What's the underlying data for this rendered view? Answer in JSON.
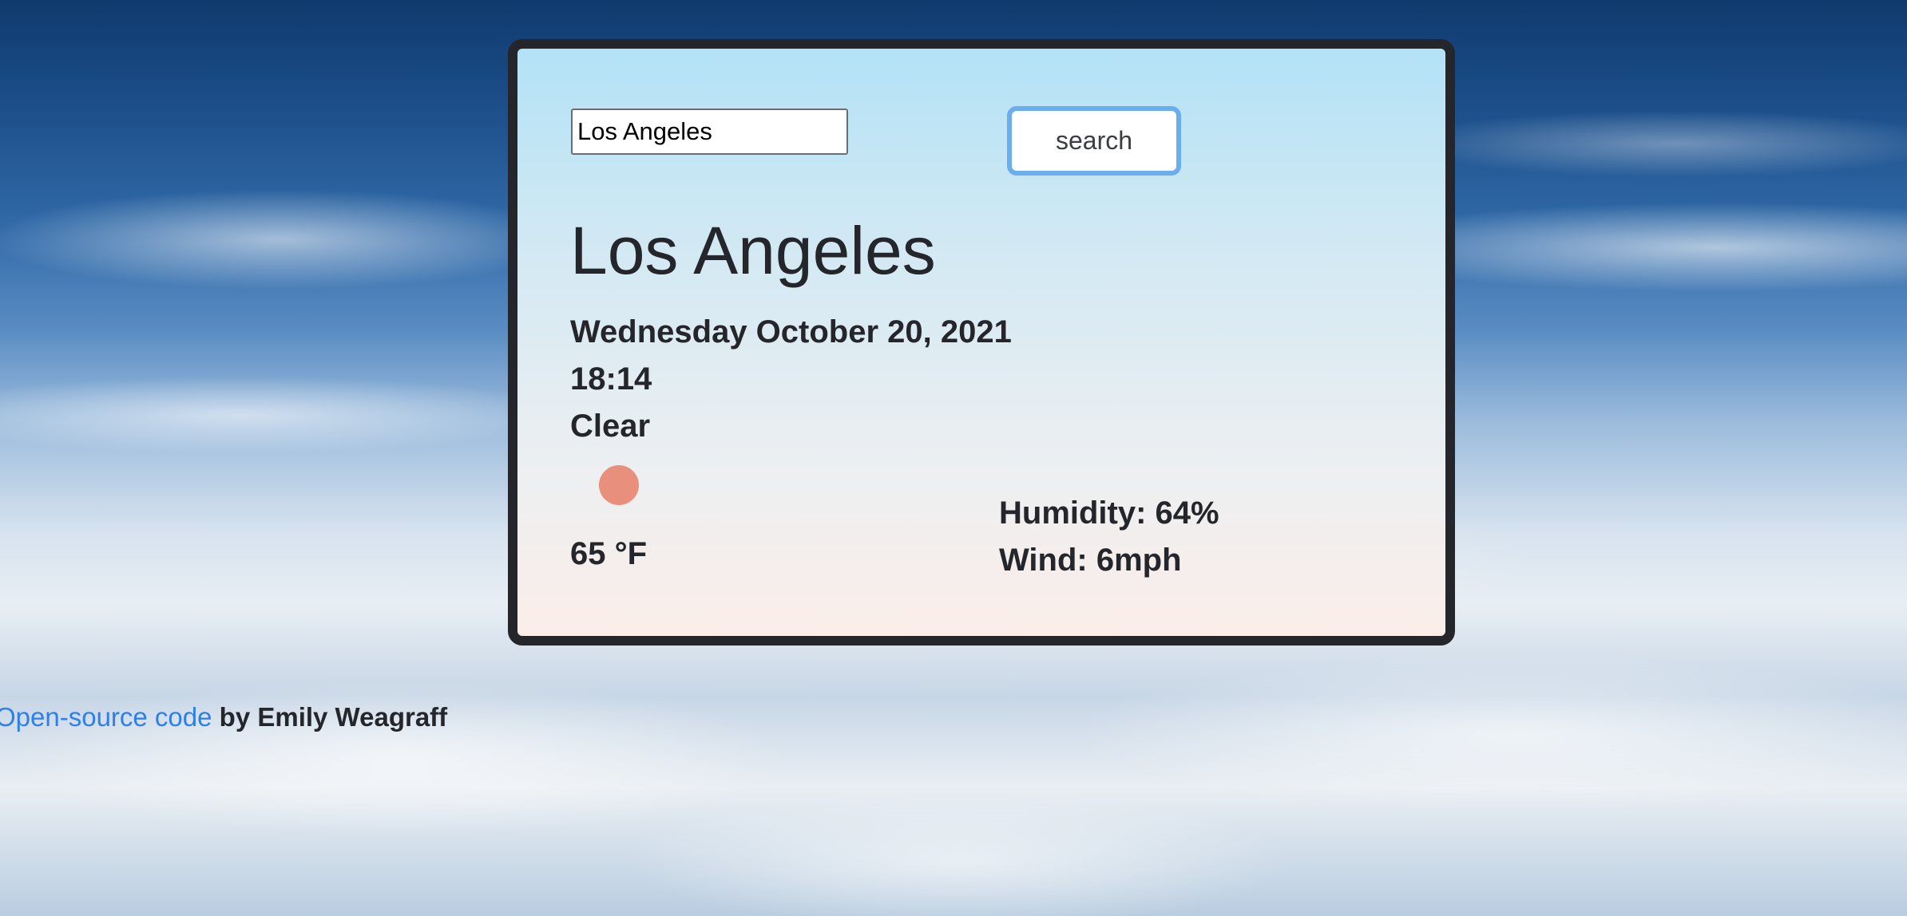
{
  "search": {
    "value": "Los Angeles",
    "button_label": "search"
  },
  "weather": {
    "city": "Los Angeles",
    "date": "Wednesday October 20, 2021",
    "time": "18:14",
    "description": "Clear",
    "icon": "sun-icon",
    "temperature": "65 °F",
    "humidity": "Humidity: 64%",
    "wind": "Wind: 6mph"
  },
  "footer": {
    "link_text": "Open-source code",
    "author_text": " by Emily Weagraff"
  },
  "colors": {
    "card_border": "#24262b",
    "button_border": "#6aaef0",
    "link": "#2f7fea",
    "sun": "#e8907b"
  }
}
